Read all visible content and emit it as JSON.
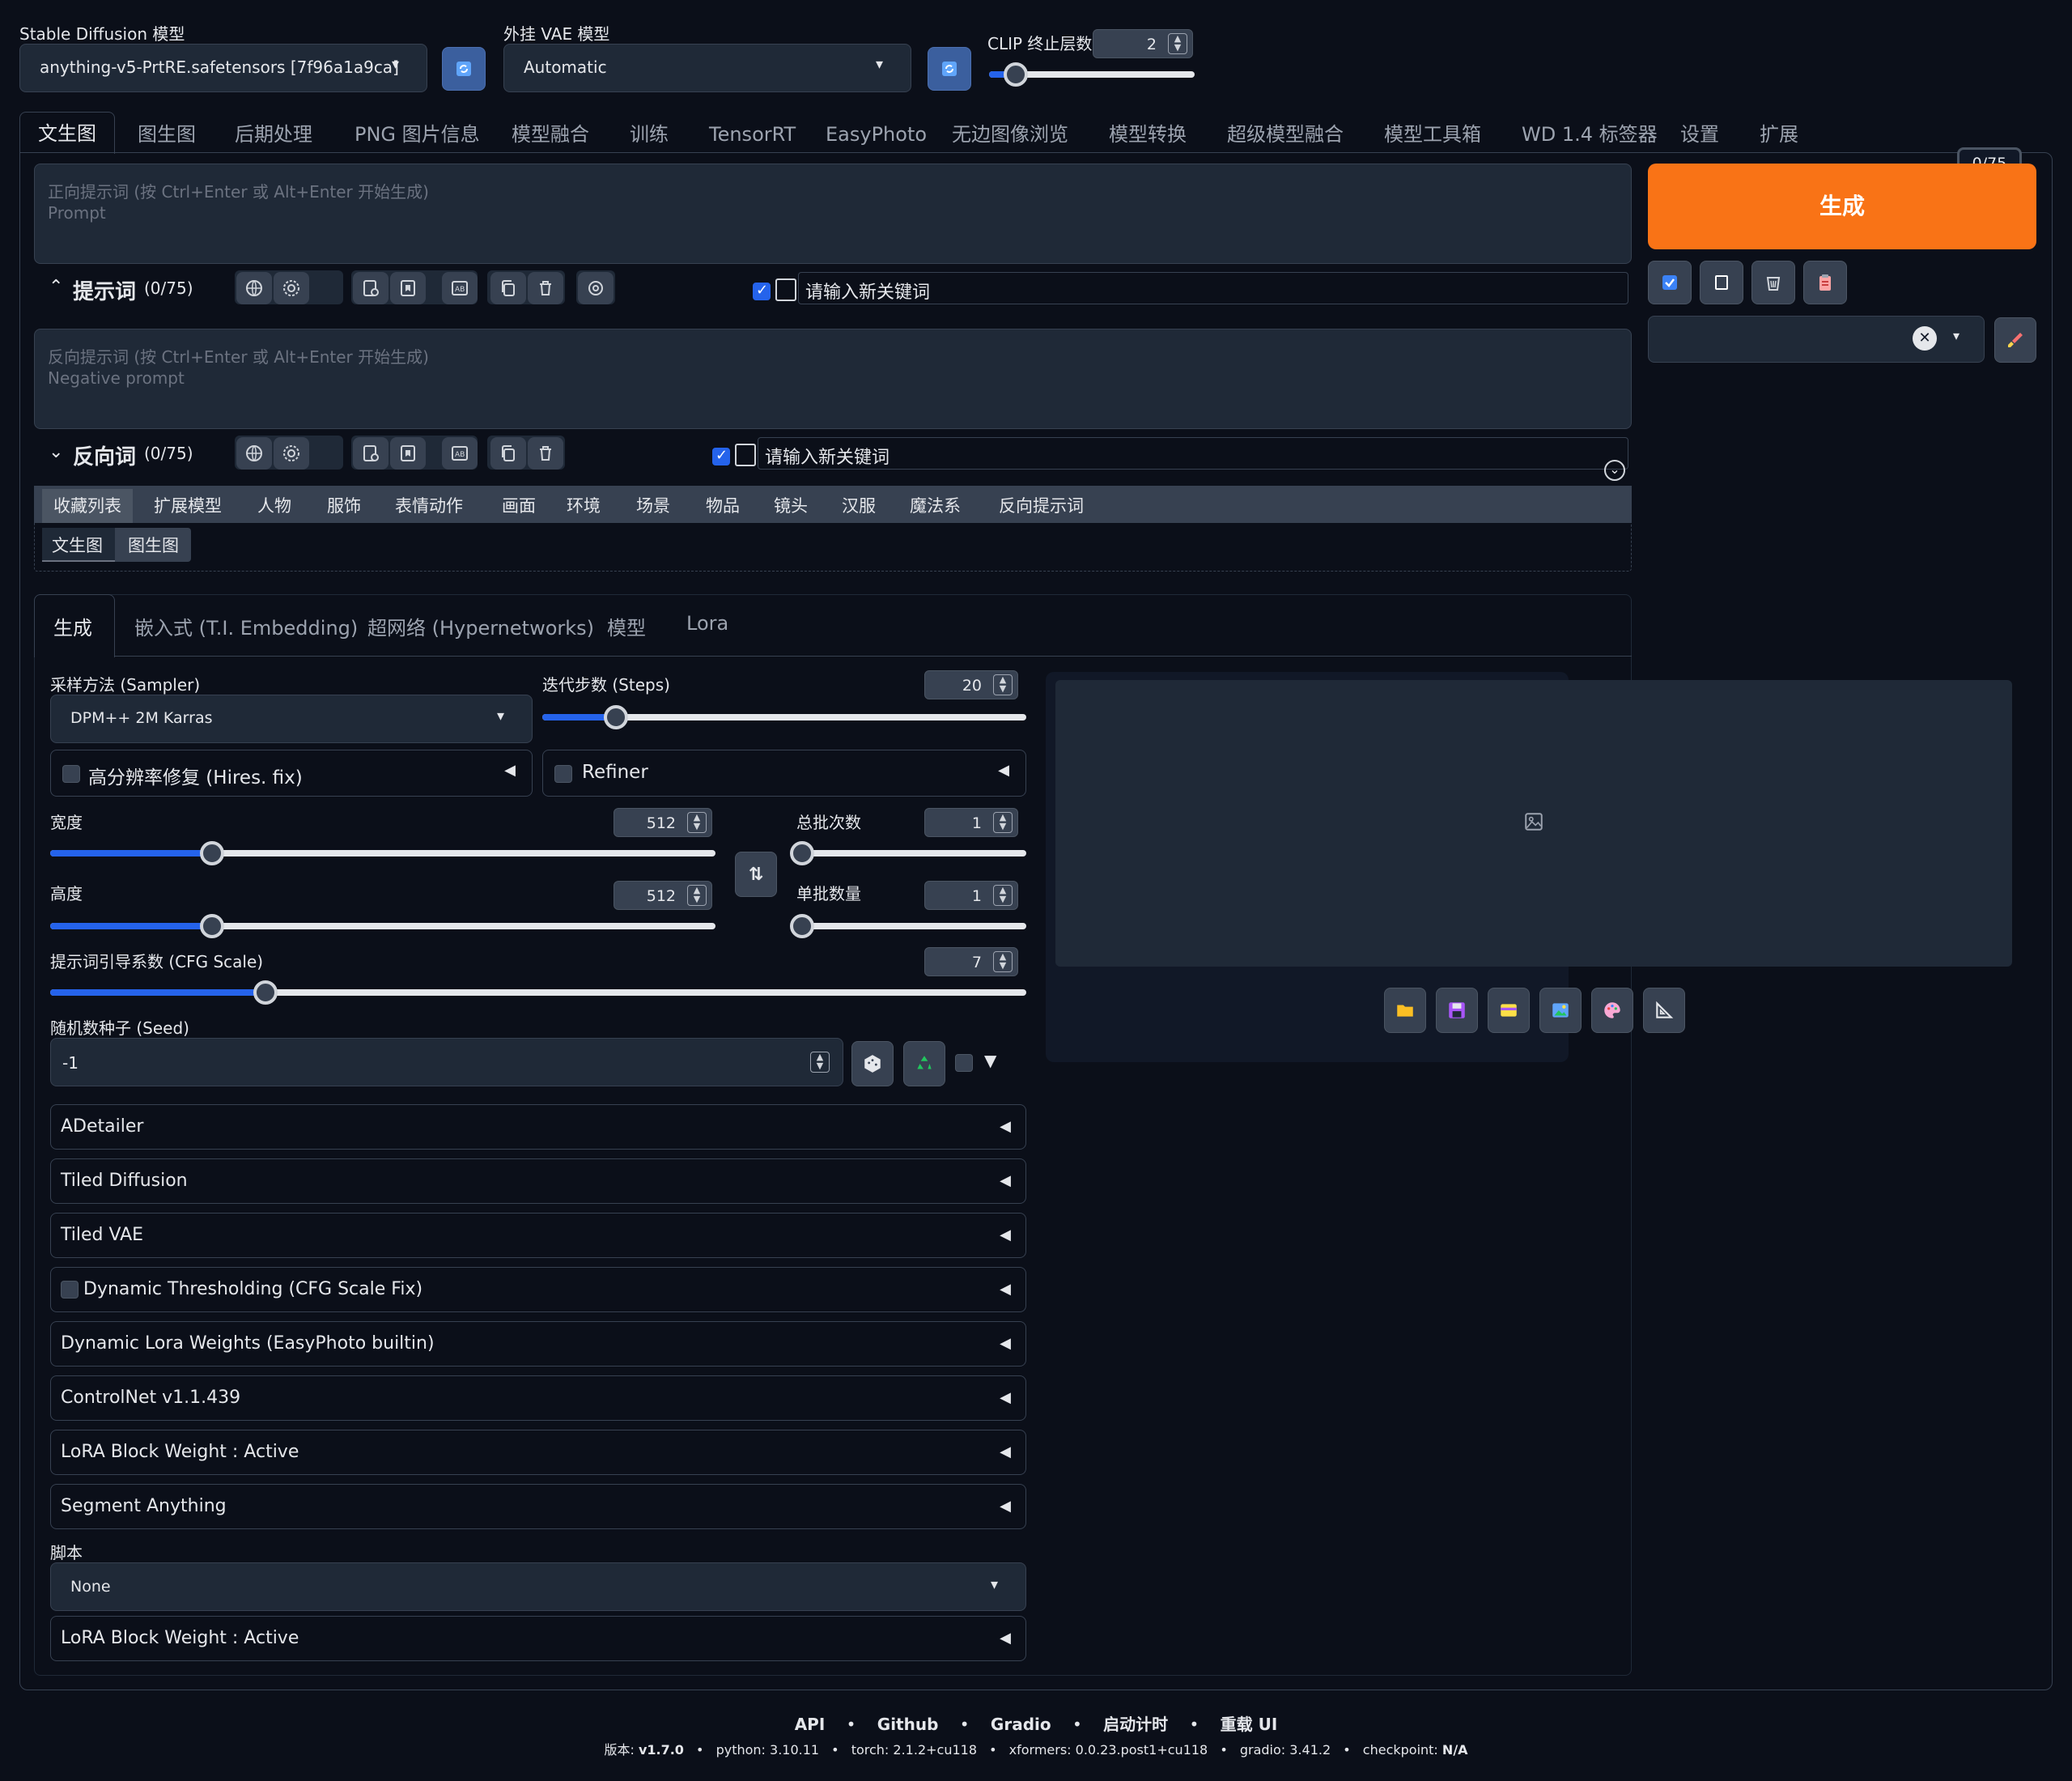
{
  "top": {
    "sd_model_label": "Stable Diffusion 模型",
    "sd_model_value": "anything-v5-PrtRE.safetensors [7f96a1a9ca]",
    "vae_label": "外挂 VAE 模型",
    "vae_value": "Automatic",
    "clip_label": "CLIP 终止层数",
    "clip_value": "2"
  },
  "main_tabs": [
    "文生图",
    "图生图",
    "后期处理",
    "PNG 图片信息",
    "模型融合",
    "训练",
    "TensorRT",
    "EasyPhoto",
    "无边图像浏览",
    "模型转换",
    "超级模型融合",
    "模型工具箱",
    "WD 1.4 标签器",
    "设置",
    "扩展"
  ],
  "prompt": {
    "placeholder_line1": "正向提示词 (按 Ctrl+Enter 或 Alt+Enter 开始生成)",
    "placeholder_line2": "Prompt",
    "token_counter": "0/75",
    "title": "提示词",
    "count": "(0/75)",
    "keyword_placeholder": "请输入新关键词"
  },
  "negative": {
    "placeholder_line1": "反向提示词 (按 Ctrl+Enter 或 Alt+Enter 开始生成)",
    "placeholder_line2": "Negative prompt",
    "title": "反向词",
    "count": "(0/75)",
    "keyword_placeholder": "请输入新关键词"
  },
  "generate_label": "生成",
  "category_tabs": [
    "收藏列表",
    "扩展模型",
    "人物",
    "服饰",
    "表情动作",
    "画面",
    "环境",
    "场景",
    "物品",
    "镜头",
    "汉服",
    "魔法系",
    "反向提示词"
  ],
  "sub_tabs": [
    "文生图",
    "图生图"
  ],
  "gen_tabs": [
    "生成",
    "嵌入式 (T.I. Embedding)",
    "超网络 (Hypernetworks)",
    "模型",
    "Lora"
  ],
  "sampler": {
    "label": "采样方法 (Sampler)",
    "value": "DPM++ 2M Karras"
  },
  "steps": {
    "label": "迭代步数 (Steps)",
    "value": "20",
    "fraction": 0.14
  },
  "hires_label": "高分辨率修复 (Hires. fix)",
  "refiner_label": "Refiner",
  "width": {
    "label": "宽度",
    "value": "512",
    "fraction": 0.235
  },
  "height": {
    "label": "高度",
    "value": "512",
    "fraction": 0.235
  },
  "batch_count": {
    "label": "总批次数",
    "value": "1",
    "fraction": 0.0
  },
  "batch_size": {
    "label": "单批数量",
    "value": "1",
    "fraction": 0.0
  },
  "cfg": {
    "label": "提示词引导系数 (CFG Scale)",
    "value": "7",
    "fraction": 0.215
  },
  "seed": {
    "label": "随机数种子 (Seed)",
    "value": "-1"
  },
  "accordions": [
    "ADetailer",
    "Tiled Diffusion",
    "Tiled VAE",
    "Dynamic Thresholding (CFG Scale Fix)",
    "Dynamic Lora Weights (EasyPhoto builtin)",
    "ControlNet v1.1.439",
    "LoRA Block Weight : Active",
    "Segment Anything"
  ],
  "script": {
    "label": "脚本",
    "value": "None"
  },
  "last_accordion": "LoRA Block Weight : Active",
  "footer": {
    "links": [
      "API",
      "Github",
      "Gradio",
      "启动计时",
      "重载 UI"
    ],
    "version_label": "版本:",
    "version": "v1.7.0",
    "python": "python: 3.10.11",
    "torch": "torch: 2.1.2+cu118",
    "xformers": "xformers: 0.0.23.post1+cu118",
    "gradio": "gradio: 3.41.2",
    "checkpoint_label": "checkpoint:",
    "checkpoint": "N/A"
  },
  "colors": {
    "accent": "#2563eb",
    "generate": "#f97316",
    "bg": "#0b0f19",
    "panel": "#1f2937"
  }
}
